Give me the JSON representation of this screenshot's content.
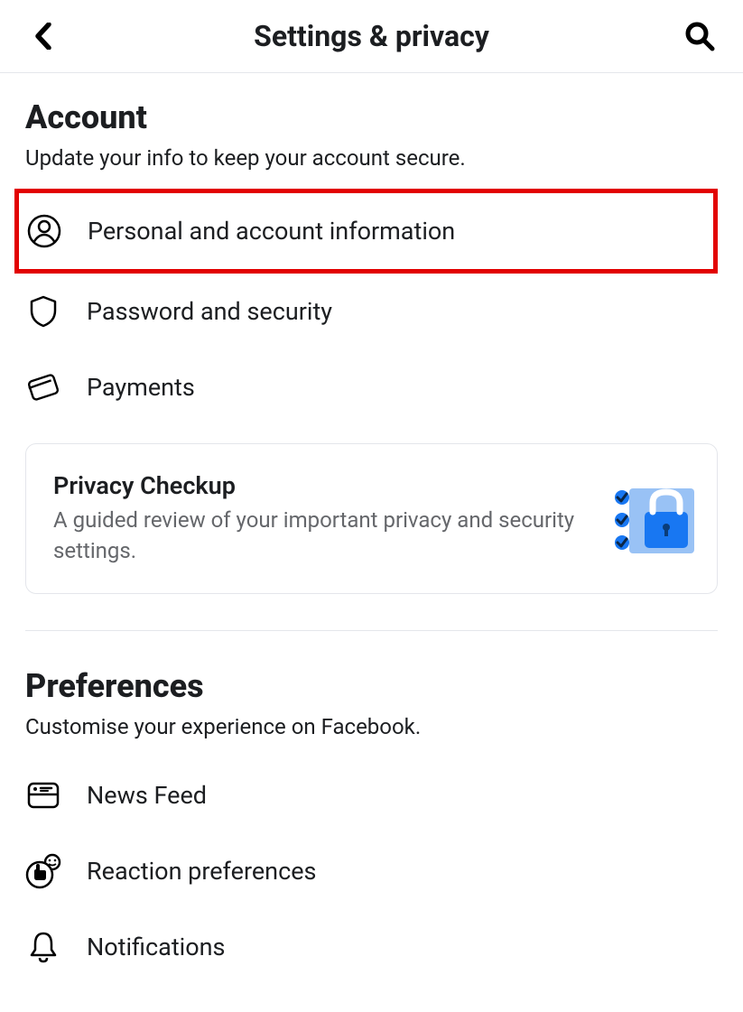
{
  "header": {
    "title": "Settings & privacy"
  },
  "sections": {
    "account": {
      "title": "Account",
      "subtitle": "Update your info to keep your account secure.",
      "items": [
        {
          "label": "Personal and account information"
        },
        {
          "label": "Password and security"
        },
        {
          "label": "Payments"
        }
      ]
    },
    "privacy_card": {
      "title": "Privacy Checkup",
      "subtitle": "A guided review of your important privacy and security settings."
    },
    "preferences": {
      "title": "Preferences",
      "subtitle": "Customise your experience on Facebook.",
      "items": [
        {
          "label": "News Feed"
        },
        {
          "label": "Reaction preferences"
        },
        {
          "label": "Notifications"
        }
      ]
    }
  }
}
